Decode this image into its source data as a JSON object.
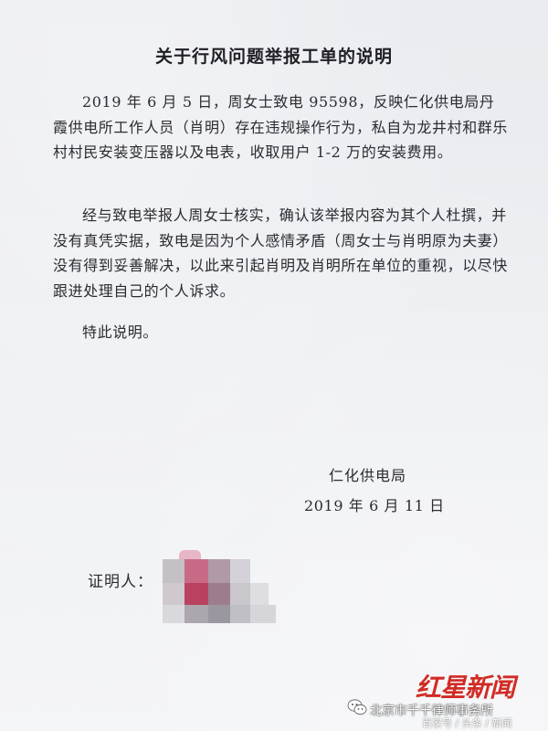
{
  "document": {
    "title": "关于行风问题举报工单的说明",
    "paragraphs": [
      "2019 年 6 月 5 日，周女士致电 95598，反映仁化供电局丹霞供电所工作人员（肖明）存在违规操作行为，私自为龙井村和群乐村村民安装变压器以及电表，收取用户 1-2 万的安装费用。",
      "经与致电举报人周女士核实，确认该举报内容为其个人杜撰，并没有真凭实据，致电是因为个人感情矛盾（周女士与肖明原为夫妻）没有得到妥善解决，以此来引起肖明及肖明所在单位的重视，以尽快跟进处理自己的个人诉求。",
      "特此说明。"
    ],
    "signature": {
      "organization": "仁化供电局",
      "date": "2019 年 6 月 11 日"
    },
    "witness": {
      "label": "证明人："
    }
  },
  "watermark": {
    "logo_text": "红星新闻",
    "brand_text": "北京市千千律师事务所",
    "source_text": "百家号 / 头条 / 新闻",
    "logo_color": "#d12b24"
  }
}
